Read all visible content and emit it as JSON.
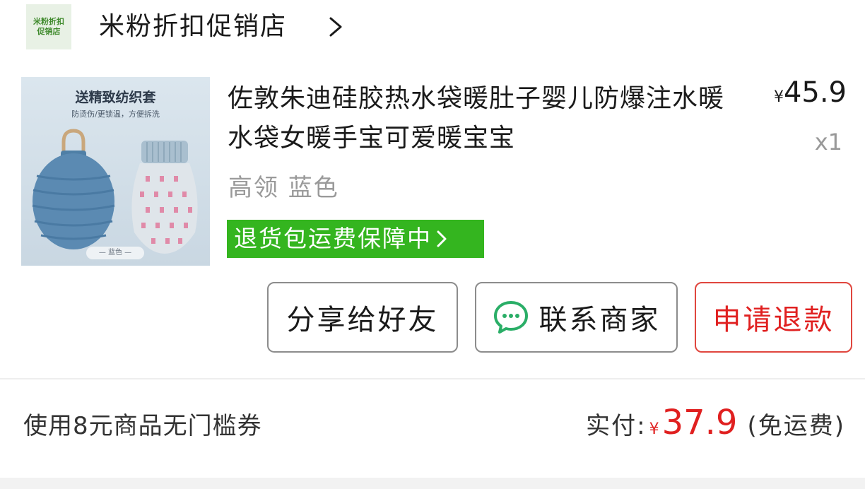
{
  "store": {
    "logo_text": "米粉折扣促销店",
    "name": "米粉折扣促销店"
  },
  "product": {
    "image": {
      "title": "送精致纺织套",
      "subtitle": "防烫伤/更锁温，方便拆洗",
      "label": "蓝色"
    },
    "title": "佐敦朱迪硅胶热水袋暖肚子婴儿防爆注水暖水袋女暖手宝可爱暖宝宝",
    "spec": "高领 蓝色",
    "price_symbol": "¥",
    "price": "45.9",
    "quantity": "x1",
    "guarantee_badge": "退货包运费保障中"
  },
  "actions": {
    "share_label": "分享给好友",
    "contact_label": "联系商家",
    "refund_label": "申请退款"
  },
  "summary": {
    "coupon_text": "使用8元商品无门槛券",
    "paid_label": "实付:",
    "currency": "¥",
    "paid_amount": "37.9",
    "shipping_note": "(免运费)"
  },
  "colors": {
    "accent_green": "#34b51f",
    "wechat_green": "#2aae67",
    "refund_red": "#e02020",
    "muted_gray": "#9a9a9a"
  },
  "icons": [
    "chevron-right-icon",
    "chat-bubble-icon"
  ]
}
